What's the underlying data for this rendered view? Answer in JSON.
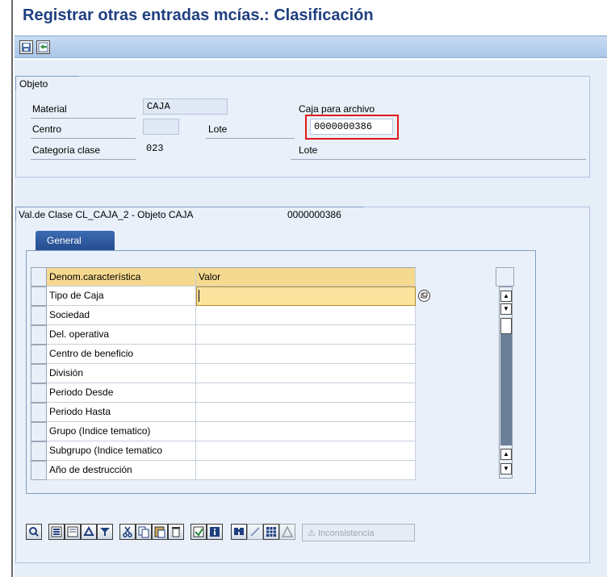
{
  "window": {
    "title": "Registrar otras entradas mcías.: Clasificación"
  },
  "toolbar": {
    "icons": [
      "save-icon",
      "back-icon"
    ]
  },
  "objeto": {
    "tab_label": "Objeto",
    "material_label": "Material",
    "material_value": "CAJA",
    "material_desc": "Caja para archivo",
    "centro_label": "Centro",
    "centro_value": "",
    "lote_label": "Lote",
    "lote_value": "0000000386",
    "categoria_label": "Categoría clase",
    "categoria_value": "023",
    "categoria_desc": "Lote"
  },
  "valclase": {
    "header_label": "Val.de Clase CL_CAJA_2 - Objeto CAJA",
    "header_value": "0000000386",
    "tab_general": "General",
    "columns": [
      "Denom.característica",
      "Valor"
    ],
    "rows": [
      {
        "name": "Tipo de Caja",
        "value": ""
      },
      {
        "name": "Sociedad",
        "value": ""
      },
      {
        "name": "Del. operativa",
        "value": ""
      },
      {
        "name": "Centro de beneficio",
        "value": ""
      },
      {
        "name": "División",
        "value": ""
      },
      {
        "name": "Periodo Desde",
        "value": ""
      },
      {
        "name": "Periodo Hasta",
        "value": ""
      },
      {
        "name": "Grupo (Indice tematico)",
        "value": ""
      },
      {
        "name": "Subgrupo (Indice tematico",
        "value": ""
      },
      {
        "name": "Año de destrucción",
        "value": ""
      }
    ]
  },
  "bottom_toolbar": {
    "inconsistencia_label": "Inconsistencia",
    "icons": [
      "details-icon",
      "select-all-icon",
      "deselect-all-icon",
      "sort-icon",
      "filter-icon",
      "cut-icon",
      "copy-icon",
      "paste-icon",
      "delete-icon",
      "values-icon",
      "info-icon",
      "find-icon",
      "find-next-icon",
      "grid-icon",
      "warning-icon"
    ]
  },
  "colors": {
    "title": "#1f3f7f",
    "toolbar": "#bcd3ee",
    "highlight": "#e01818",
    "header_row": "#f5d98e",
    "active_cell": "#fbe39e"
  }
}
